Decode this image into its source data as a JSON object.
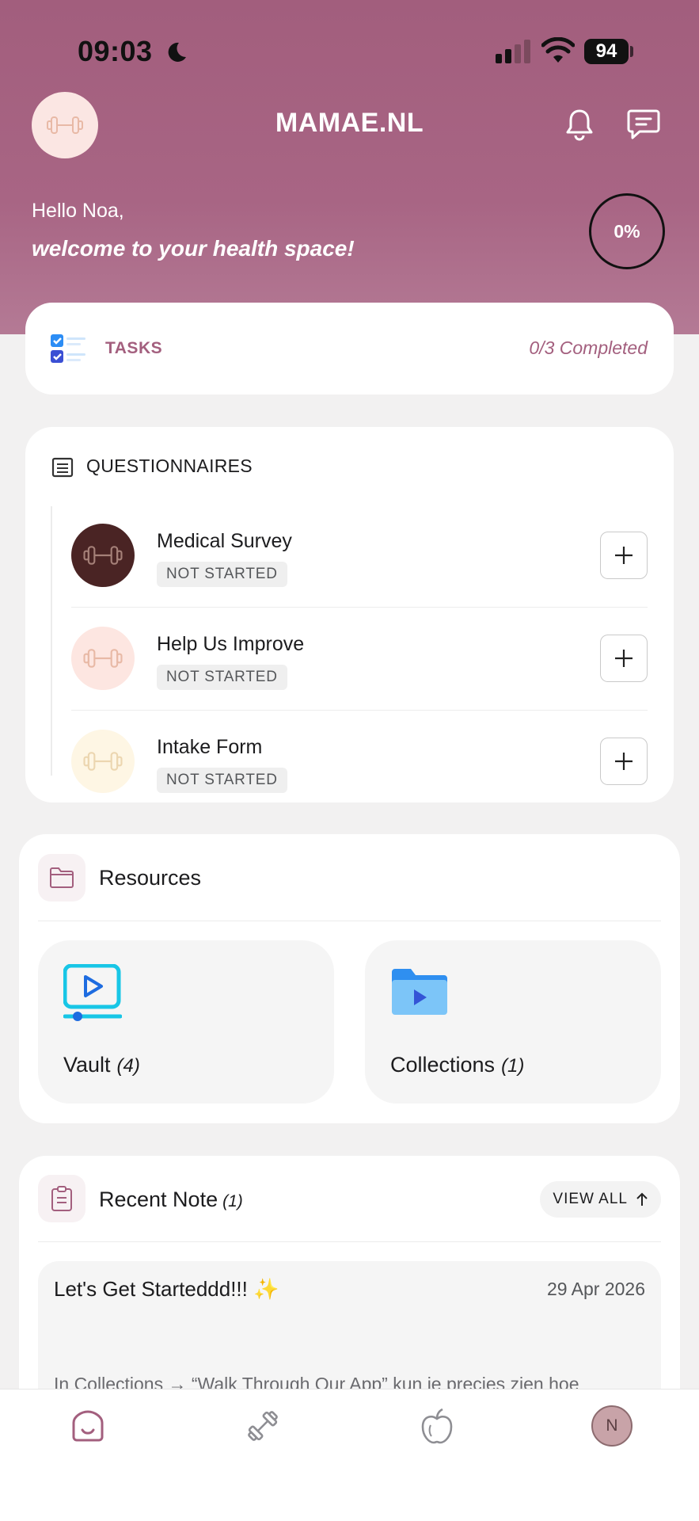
{
  "status_bar": {
    "time": "09:03",
    "battery": "94"
  },
  "header": {
    "title": "MAMAE.NL",
    "greeting": "Hello Noa,",
    "welcome": "welcome to your health space!",
    "progress": "0%"
  },
  "tasks": {
    "label": "TASKS",
    "status": "0/3 Completed"
  },
  "questionnaires": {
    "title": "QUESTIONNAIRES",
    "items": [
      {
        "name": "Medical Survey",
        "status": "NOT STARTED",
        "avatar_color": "#4a2424"
      },
      {
        "name": "Help Us Improve",
        "status": "NOT STARTED",
        "avatar_color": "#fde6e1"
      },
      {
        "name": "Intake Form",
        "status": "NOT STARTED",
        "avatar_color": "#fef6e4"
      }
    ]
  },
  "resources": {
    "title": "Resources",
    "tiles": [
      {
        "label": "Vault",
        "count": "(4)"
      },
      {
        "label": "Collections",
        "count": "(1)"
      }
    ]
  },
  "recent_note": {
    "title": "Recent Note",
    "count": "(1)",
    "view_all": "VIEW ALL",
    "entry": {
      "title": "Let's Get Starteddd!!! ✨",
      "date": "29 Apr 2026",
      "preview": "In Collections → “Walk Through Our App” kun je precies zien hoe"
    }
  },
  "bottom_nav": {
    "items": [
      "home-icon",
      "dumbbell-icon",
      "apple-icon",
      "profile-avatar"
    ],
    "profile_initial": "N"
  },
  "colors": {
    "brand": "#a25e7d",
    "accent_text": "#a35f7e"
  }
}
